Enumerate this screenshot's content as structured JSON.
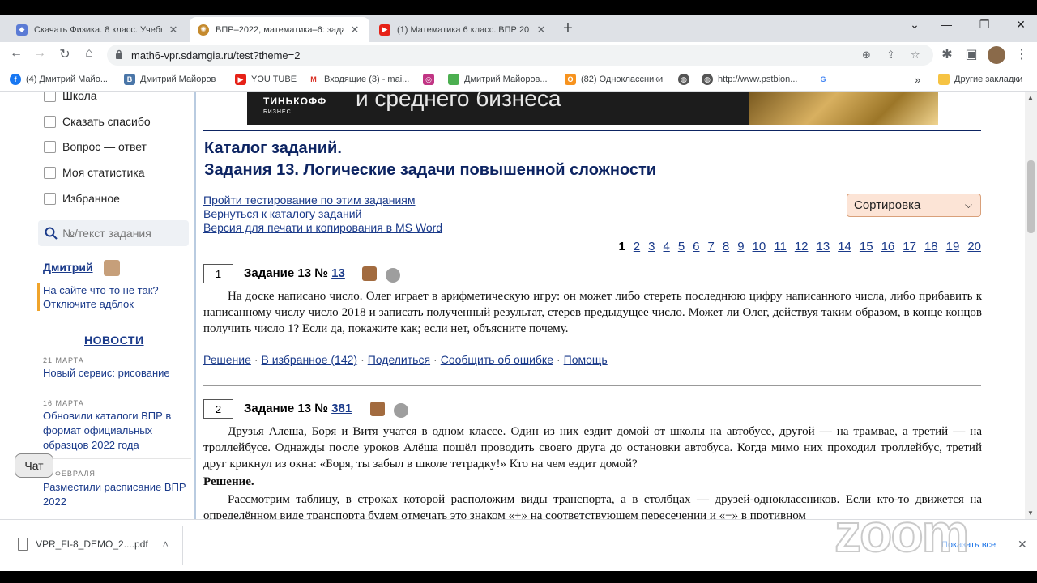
{
  "browser": {
    "tabs": [
      {
        "title": "Скачать Физика. 8 класс. Учебн"
      },
      {
        "title": "ВПР–2022, математика–6: задан"
      },
      {
        "title": "(1) Математика 6 класс. ВПР 20"
      }
    ],
    "url": "math6-vpr.sdamgia.ru/test?theme=2",
    "bookmarks": [
      {
        "label": "(4) Дмитрий Майо..."
      },
      {
        "label": "Дмитрий Майоров"
      },
      {
        "label": "YOU TUBE"
      },
      {
        "label": "Входящие (3) - mai..."
      },
      {
        "label": ""
      },
      {
        "label": "Дмитрий Майоров..."
      },
      {
        "label": "(82) Одноклассники"
      },
      {
        "label": ""
      },
      {
        "label": "http://www.pstbion..."
      },
      {
        "label": ""
      }
    ],
    "other_bookmarks": "Другие закладки",
    "chevron": "»"
  },
  "sidebar": {
    "menu": [
      "Школа",
      "Сказать спасибо",
      "Вопрос — ответ",
      "Моя статистика",
      "Избранное"
    ],
    "search_placeholder": "№/текст задания",
    "user_name": "Дмитрий",
    "adblock": "На сайте что-то не так? Отключите адблок",
    "news_heading": "НОВОСТИ",
    "news": [
      {
        "date": "21 МАРТА",
        "text": "Новый сервис: рисование"
      },
      {
        "date": "16 МАРТА",
        "text": "Обновили каталоги ВПР в формат официальных образцов 2022 года"
      },
      {
        "date": "ФЕВРАЛЯ",
        "text": "Разместили расписание ВПР 2022"
      }
    ],
    "chat": "Чат"
  },
  "banner": {
    "logo": "ТИНЬКОФФ",
    "logo_sub": "БИЗНЕС",
    "text": "и среднего бизнеса"
  },
  "main": {
    "title1": "Каталог заданий.",
    "title2": "Задания 13. Логические задачи повышенной сложности",
    "links": [
      "Пройти тестирование по этим заданиям",
      "Вернуться к каталогу заданий",
      "Версия для печати и копирования в MS Word"
    ],
    "sort_label": "Сортировка",
    "pages": [
      "1",
      "2",
      "3",
      "4",
      "5",
      "6",
      "7",
      "8",
      "9",
      "10",
      "11",
      "12",
      "13",
      "14",
      "15",
      "16",
      "17",
      "18",
      "19",
      "20"
    ],
    "current_page": "1",
    "tasks": [
      {
        "index": "1",
        "label": "Задание 13 №",
        "number": "13",
        "text": "На доске написано число. Олег играет в арифметическую игру: он может либо стереть последнюю цифру написанного числа, либо прибавить к написанному числу число 2018 и записать полученный результат, стерев предыдущее число. Может ли Олег, действуя таким образом, в конце концов получить число 1? Если да, покажите как; если нет, объясните почему.",
        "actions": [
          "Решение",
          "В избранное (142)",
          "Поделиться",
          "Сообщить об ошибке",
          "Помощь"
        ]
      },
      {
        "index": "2",
        "label": "Задание 13 №",
        "number": "381",
        "text": "Друзья Алеша, Боря и Витя учатся в одном классе. Один из них ездит домой от школы на автобусе, другой — на трамвае, а третий — на троллейбусе. Однажды после уроков Алёша пошёл проводить своего друга до остановки автобуса. Когда мимо них проходил троллейбус, третий друг крикнул из окна: «Боря, ты забыл в школе тетрадку!» Кто на чем ездит домой?",
        "solution_heading": "Решение.",
        "solution_text": "Рассмотрим таблицу, в строках которой расположим виды транспорта, а в столбцах — друзей-одноклассников. Если кто-то движется на определённом виде транспорта будем отмечать это знаком «+» на соответствующем пересечении и «−» в противном"
      }
    ]
  },
  "downloads": {
    "file": "VPR_FI-8_DEMO_2....pdf",
    "show_all": "Показать все"
  },
  "watermark": "zoom",
  "colors": {
    "accent": "#0d2462",
    "link": "#1a3a8a",
    "sort_bg": "#fce4d6"
  }
}
